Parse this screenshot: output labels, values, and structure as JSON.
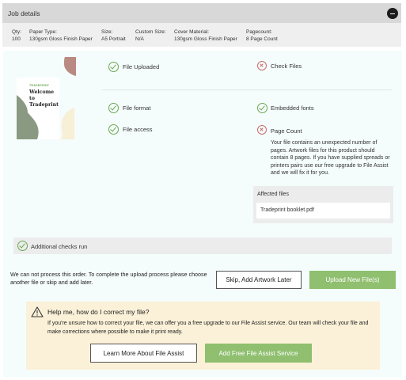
{
  "header": {
    "title": "Job details"
  },
  "specs": [
    {
      "label": "Qty:",
      "value": "100"
    },
    {
      "label": "Paper Type:",
      "value": "130gsm Gloss Finish Paper"
    },
    {
      "label": "Size:",
      "value": "A5 Portrait"
    },
    {
      "label": "Custom Size:",
      "value": "N/A"
    },
    {
      "label": "Cover Material:",
      "value": "130gsm Gloss Finish Paper"
    },
    {
      "label": "Pagecount:",
      "value": "8 Page Count"
    }
  ],
  "preview": {
    "brand": "TRADEPRINT",
    "heading": "Welcome to Tradeprint"
  },
  "checks": {
    "file_uploaded": "File Uploaded",
    "check_files": "Check Files",
    "file_format": "File format",
    "embedded_fonts": "Embedded fonts",
    "file_access": "File access",
    "page_count": "Page Count",
    "page_count_desc": "Your file contains an unexpected number of pages. Artwork files for this product should contain 8 pages. If you have supplied spreads or printers pairs use our free upgrade to File Assist and we will fix it for you.",
    "additional": "Additional checks run"
  },
  "affected": {
    "title": "Affected files",
    "file": "Tradeprint booklet.pdf"
  },
  "actions": {
    "message": "We can not process this order. To complete the upload process please choose another file or skip and add later.",
    "skip_label": "Skip, Add Artwork Later",
    "upload_label": "Upload New File(s)"
  },
  "help": {
    "title": "Help me, how do I correct my file?",
    "text": "If you're unsure how to correct your file, we can offer you a free upgrade to our File Assist service. Our team will check your file and make corrections where possible to make it print ready.",
    "learn_label": "Learn More About File Assist",
    "add_label": "Add Free File Assist Service"
  },
  "colors": {
    "success": "#6aa84f",
    "error": "#cc6b6b",
    "primary_button": "#8fbf6f",
    "help_bg": "#fbf1d8"
  }
}
